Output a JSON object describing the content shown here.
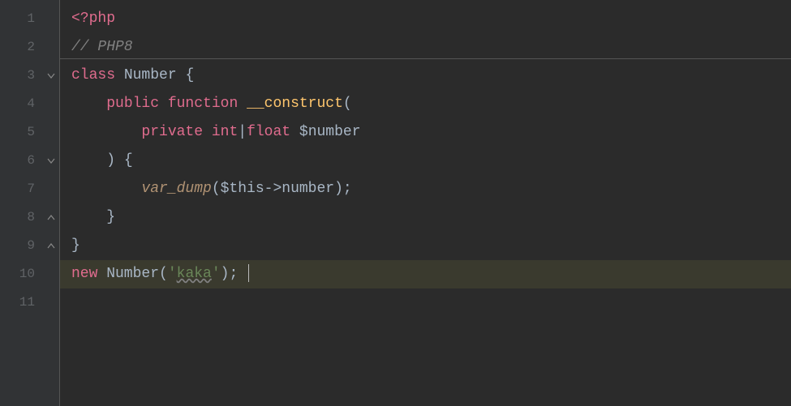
{
  "gutter": {
    "lines": [
      "1",
      "2",
      "3",
      "4",
      "5",
      "6",
      "7",
      "8",
      "9",
      "10",
      "11"
    ]
  },
  "code": {
    "l1_open": "<?php",
    "l2_comment": "// PHP8",
    "l3_class": "class",
    "l3_name": " Number ",
    "l3_brace": "{",
    "l4_pub": "public",
    "l4_fn": " function ",
    "l4_magic": "__construct",
    "l4_paren": "(",
    "l5_priv": "private",
    "l5_int": " int",
    "l5_pipe": "|",
    "l5_float": "float ",
    "l5_var": "$number",
    "l6_close": ") {",
    "l7_fn": "var_dump",
    "l7_p1": "(",
    "l7_this": "$this",
    "l7_arrow": "->",
    "l7_prop": "number",
    "l7_p2": ");",
    "l8_brace": "}",
    "l9_brace": "}",
    "l10_new": "new",
    "l10_name": " Number(",
    "l10_q1": "'",
    "l10_str": "kaka",
    "l10_q2": "'",
    "l10_end": "); "
  },
  "indent": {
    "i1": "    ",
    "i2": "        ",
    "i3": "            "
  }
}
